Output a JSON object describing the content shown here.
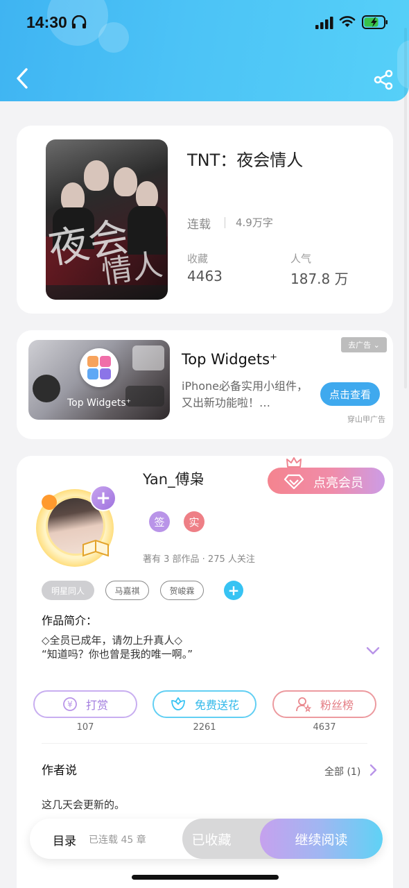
{
  "status_bar": {
    "time": "14:30"
  },
  "book": {
    "title": "TNT：夜会情人",
    "status": "连载",
    "word_count": "4.9万字",
    "collect_label": "收藏",
    "collect_value": "4463",
    "popularity_label": "人气",
    "popularity_value": "187.8 万"
  },
  "ad": {
    "image_label": "Top Widgets⁺",
    "title": "Top Widgets⁺",
    "description": "iPhone必备实用小组件，又出新功能啦！…",
    "tag": "去广告 ⌄",
    "cta": "点击查看",
    "source": "穿山甲广告"
  },
  "author": {
    "name": "Yan_傅枭",
    "vip_label": "点亮会员",
    "badges": [
      "签",
      "实"
    ],
    "meta": "著有 3 部作品 · 275 人关注",
    "tags": [
      "明星同人",
      "马嘉祺",
      "贺峻霖"
    ],
    "intro_label": "作品简介：",
    "intro_lines": [
      "◇全员已成年，请勿上升真人◇",
      "“知道吗？你也曾是我的唯一啊。”"
    ],
    "actions": [
      {
        "label": "打赏",
        "count": "107"
      },
      {
        "label": "免费送花",
        "count": "2261"
      },
      {
        "label": "粉丝榜",
        "count": "4637"
      }
    ],
    "say_label": "作者说",
    "say_all": "全部 (1)",
    "say_text": "这几天会更新的。"
  },
  "bottom_bar": {
    "toc_label": "目录",
    "toc_count": "已连载 45 章",
    "collected_label": "已收藏",
    "continue_label": "继续阅读"
  },
  "colors": {
    "header": "#4cc3f6",
    "purple": "#b994e8",
    "cyan": "#37c3f3",
    "coral": "#e9868c"
  }
}
